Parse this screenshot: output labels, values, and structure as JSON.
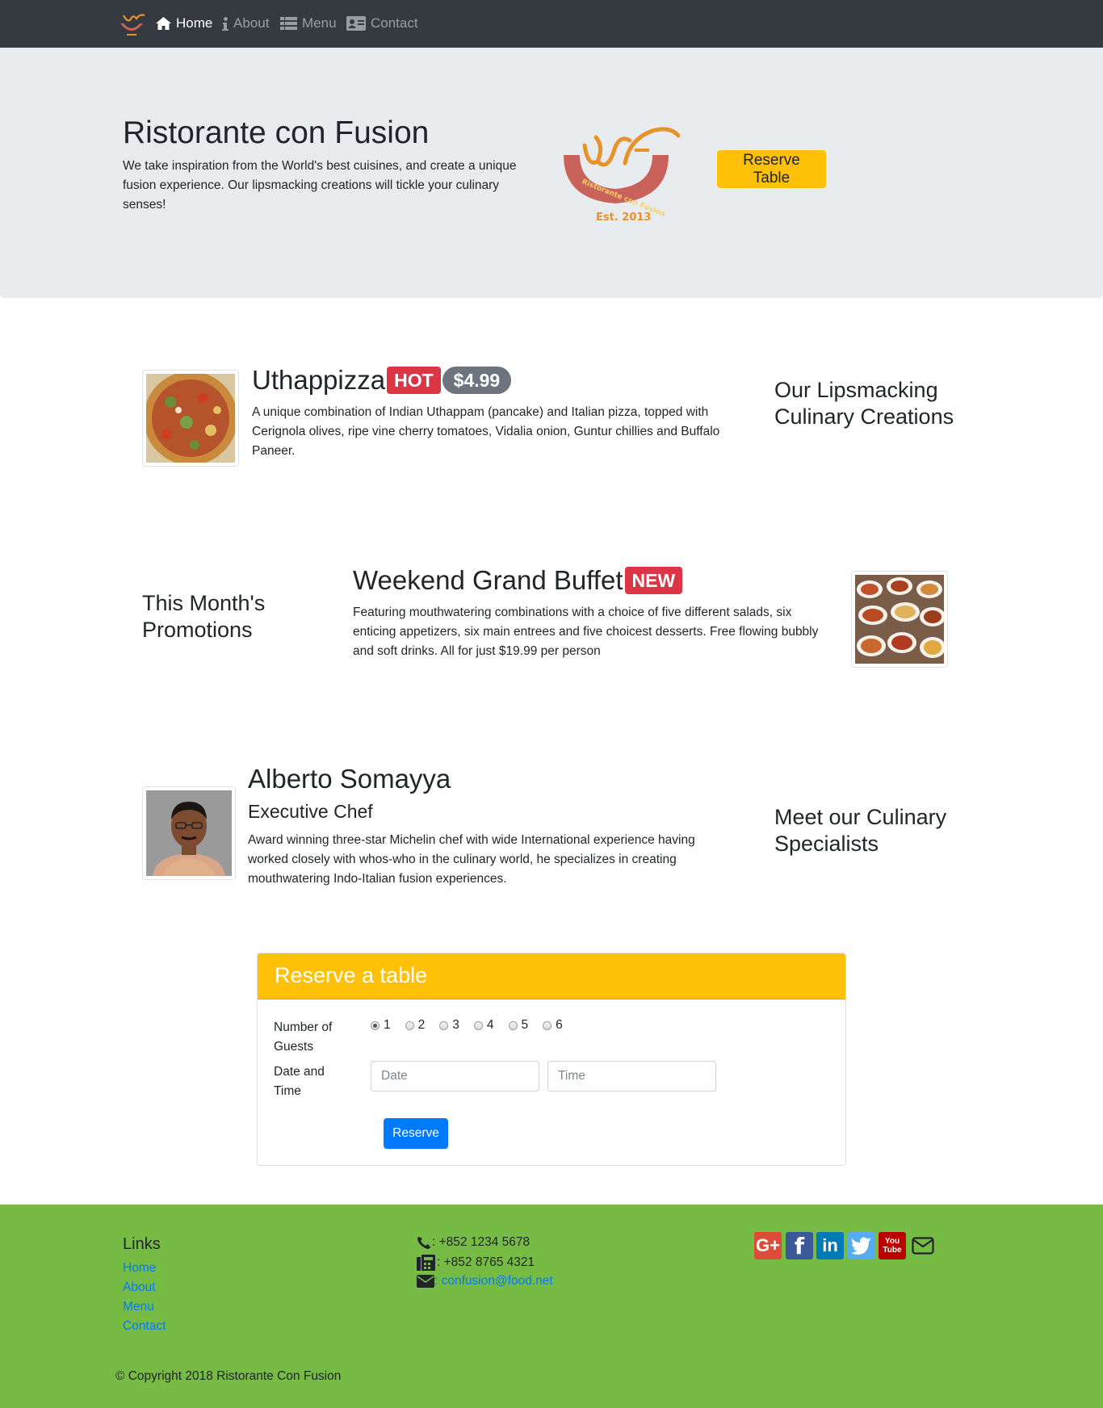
{
  "navbar": {
    "items": [
      {
        "label": "Home",
        "icon": "home-icon",
        "active": true
      },
      {
        "label": "About",
        "icon": "info-icon",
        "active": false
      },
      {
        "label": "Menu",
        "icon": "list-icon",
        "active": false
      },
      {
        "label": "Contact",
        "icon": "address-card-icon",
        "active": false
      }
    ]
  },
  "jumbotron": {
    "title": "Ristorante con Fusion",
    "text": "We take inspiration from the World's best cuisines, and create a unique fusion experience. Our lipsmacking creations will tickle your culinary senses!",
    "logo_text": "Ristorante con Fusion",
    "logo_est": "Est. 2013",
    "reserve_button": "Reserve Table"
  },
  "dish": {
    "name": "Uthappizza",
    "badge": "HOT",
    "price": "$4.99",
    "description": "A unique combination of Indian Uthappam (pancake) and Italian pizza, topped with Cerignola olives, ripe vine cherry tomatoes, Vidalia onion, Guntur chillies and Buffalo Paneer.",
    "side_heading": "Our Lipsmacking Culinary Creations"
  },
  "promotion": {
    "side_heading": "This Month's Promotions",
    "name": "Weekend Grand Buffet",
    "badge": "NEW",
    "description": "Featuring mouthwatering combinations with a choice of five different salads, six enticing appetizers, six main entrees and five choicest desserts. Free flowing bubbly and soft drinks. All for just $19.99 per person"
  },
  "leader": {
    "name": "Alberto Somayya",
    "designation": "Executive Chef",
    "description": "Award winning three-star Michelin chef with wide International experience having worked closely with whos-who in the culinary world, he specializes in creating mouthwatering Indo-Italian fusion experiences.",
    "side_heading": "Meet our Culinary Specialists"
  },
  "reserve_form": {
    "title": "Reserve a table",
    "guests_label": "Number of Guests",
    "guest_options": [
      "1",
      "2",
      "3",
      "4",
      "5",
      "6"
    ],
    "selected_guests": "1",
    "datetime_label": "Date and Time",
    "date_placeholder": "Date",
    "time_placeholder": "Time",
    "submit_label": "Reserve"
  },
  "footer": {
    "links_heading": "Links",
    "links": [
      "Home",
      "About",
      "Menu",
      "Contact"
    ],
    "phone": ": +852 1234 5678",
    "fax": ": +852 8765 4321",
    "email_prefix": ": ",
    "email": "confusion@food.net",
    "social": [
      {
        "name": "google-plus",
        "label": "G+",
        "color": "#dd4b39"
      },
      {
        "name": "facebook",
        "label": "f",
        "color": "#3b5998"
      },
      {
        "name": "linkedin",
        "label": "in",
        "color": "#007bb5"
      },
      {
        "name": "twitter",
        "label": "t",
        "color": "#55acee"
      },
      {
        "name": "youtube",
        "label": "You Tube",
        "color": "#bb0000"
      }
    ],
    "copyright": "© Copyright 2018 Ristorante Con Fusion"
  },
  "colors": {
    "navbar": "#343a40",
    "jumbotron": "#e9ecef",
    "warning": "#ffc107",
    "danger": "#dc3545",
    "secondary": "#6c757d",
    "primary": "#007bff",
    "footer": "#76bb43"
  }
}
